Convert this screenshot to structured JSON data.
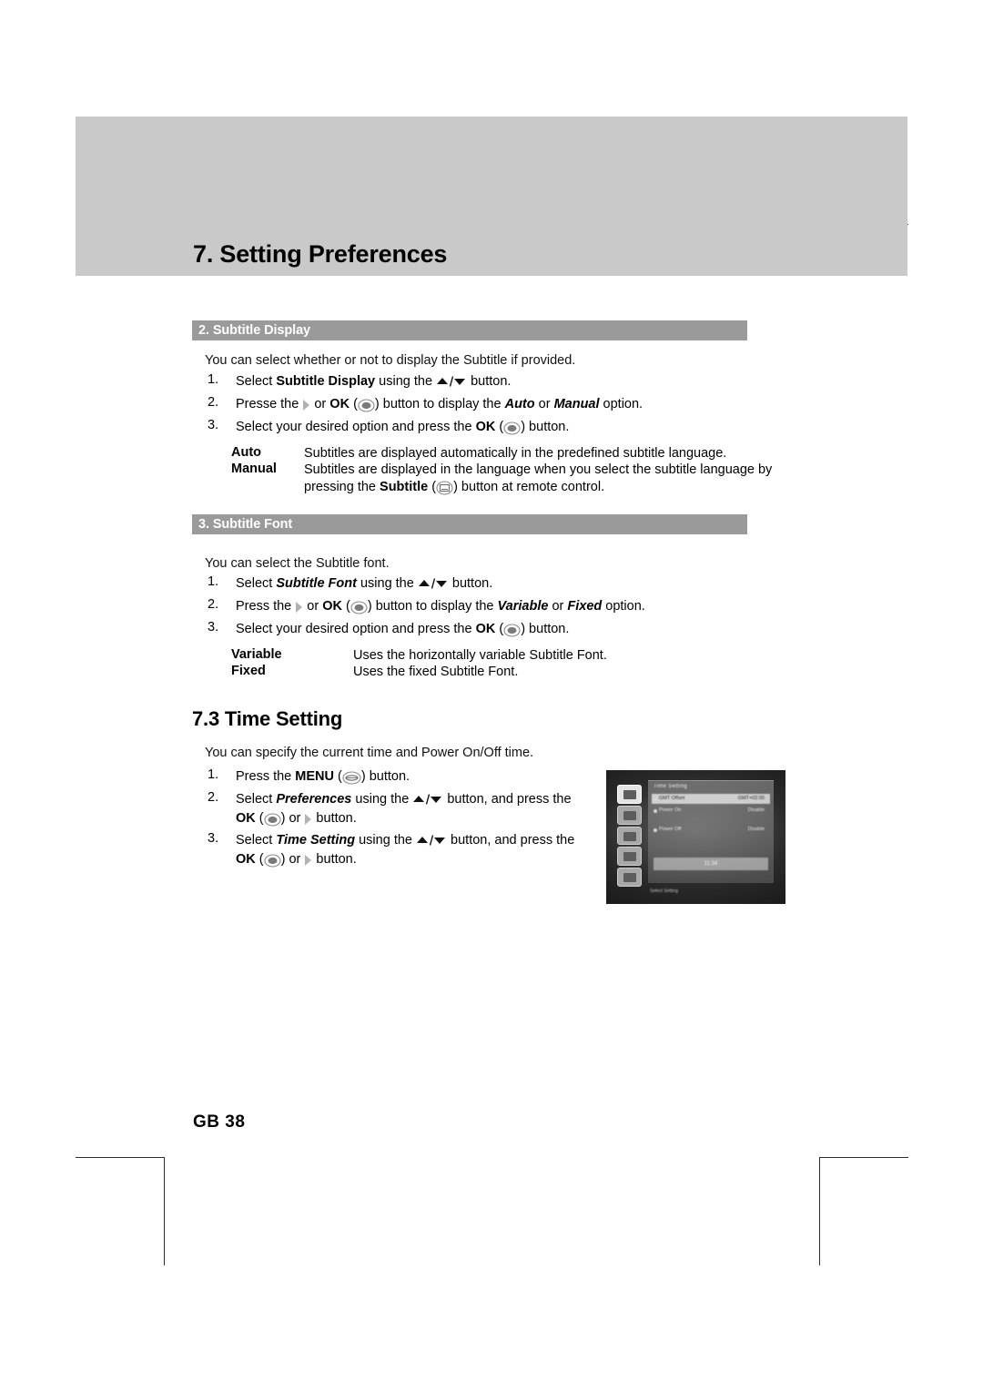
{
  "page": {
    "chapter_title": "7. Setting Preferences",
    "page_number": "GB 38"
  },
  "sections": [
    {
      "bar_label": "2. Subtitle Display",
      "intro": "You can select whether or not to display the Subtitle if provided.",
      "steps": [
        {
          "num": "1.",
          "pre": "Select ",
          "target": "Subtitle Display",
          "target_style": "bold",
          "mid": " using the ",
          "icon": "updown-arrow-icon",
          "post": " button."
        },
        {
          "num": "2.",
          "pre": "Presse the ",
          "icon1": "right-arrow-icon",
          "mid1": " or ",
          "ok": "OK",
          "icon2": "ok-round-button-icon",
          "mid2": " button to display the ",
          "opt1": "Auto",
          "between": " or ",
          "opt2": "Manual",
          "post": " option."
        },
        {
          "num": "3.",
          "pre": "Select your desired option and press the ",
          "ok": "OK",
          "icon": "ok-round-button-icon",
          "post": " button."
        }
      ],
      "definitions": [
        {
          "term": "Auto",
          "text": "Subtitles are displayed automatically in the predefined subtitle language."
        },
        {
          "term": "Manual",
          "text_line1": "Subtitles are displayed in the language when you select the subtitle language by",
          "text_line2_pre": "pressing the ",
          "text_line2_bold": "Subtitle",
          "text_line2_icon": "subtitle-button-icon",
          "text_line2_post": " button at remote control."
        }
      ]
    },
    {
      "bar_label": "3. Subtitle Font",
      "intro": "You can select the Subtitle font.",
      "steps": [
        {
          "num": "1.",
          "pre": "Select ",
          "target": "Subtitle Font",
          "target_style": "bold-italic",
          "mid": " using the ",
          "icon": "updown-arrow-icon",
          "post": " button."
        },
        {
          "num": "2.",
          "pre": "Press the ",
          "icon1": "right-arrow-icon",
          "mid1": " or ",
          "ok": "OK",
          "icon2": "ok-round-button-icon",
          "mid2": " button to display the ",
          "opt1": "Variable",
          "between": " or ",
          "opt2": "Fixed",
          "post": " option."
        },
        {
          "num": "3.",
          "pre": "Select your desired option and press the ",
          "ok": "OK",
          "icon": "ok-round-button-icon",
          "post": " button."
        }
      ],
      "definitions": [
        {
          "term": "Variable",
          "text": "Uses the horizontally variable Subtitle Font."
        },
        {
          "term": "Fixed",
          "text": "Uses the fixed Subtitle Font."
        }
      ]
    }
  ],
  "time_setting": {
    "heading": "7.3 Time Setting",
    "intro": "You can specify the current time and Power On/Off time.",
    "steps": [
      {
        "num": "1.",
        "pre": "Press the ",
        "bold": "MENU",
        "icon": "menu-oval-button-icon",
        "post": " button."
      },
      {
        "num": "2.",
        "pre": "Select ",
        "target": "Preferences",
        "mid": " using the ",
        "icon": "updown-arrow-icon",
        "post": " button, and press the",
        "cont_bold": "OK",
        "cont_icon1": "ok-round-button-icon",
        "cont_mid": " or ",
        "cont_icon2": "right-arrow-icon",
        "cont_post": " button."
      },
      {
        "num": "3.",
        "pre": "Select ",
        "target": "Time Setting",
        "mid": " using the ",
        "icon": "updown-arrow-icon",
        "post": " button, and press the",
        "cont_bold": "OK",
        "cont_icon1": "ok-round-button-icon",
        "cont_mid": " or ",
        "cont_icon2": "right-arrow-icon",
        "cont_post": " button."
      }
    ]
  },
  "osd_screenshot": {
    "alt": "Time Setting on-screen-display menu photograph",
    "panel_title": "Time Setting",
    "rows": [
      {
        "label": "GMT Offset",
        "value": "GMT+02:00"
      },
      {
        "label": "Power On",
        "value": "Disable"
      },
      {
        "label": "Power Off",
        "value": "Disable"
      }
    ],
    "clock": "11:34",
    "footer": "Select Setting"
  },
  "colors": {
    "banner_gray": "#c9c9c9",
    "section_bar_gray": "#9a9a9a",
    "text_black": "#000000",
    "bar_text_white": "#ffffff"
  }
}
